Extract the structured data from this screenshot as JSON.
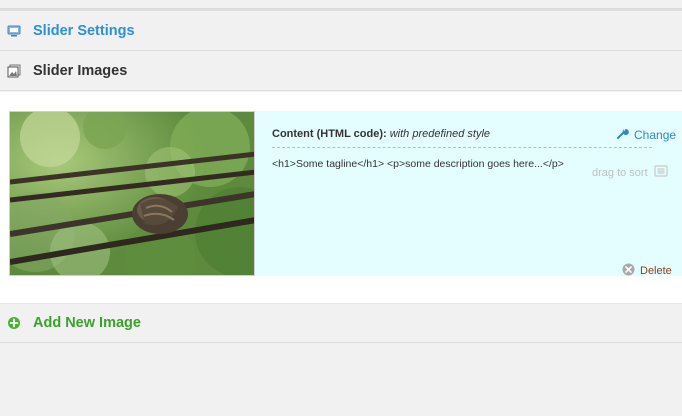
{
  "panels": {
    "settings": {
      "title": "Slider Settings",
      "icon": "monitor-icon"
    },
    "images": {
      "title": "Slider Images",
      "icon": "images-icon"
    },
    "add": {
      "title": "Add New Image",
      "icon": "plus-circle-icon"
    }
  },
  "slide": {
    "thumbnail_alt": "knotted rope against green foliage",
    "content_label": "Content (HTML code):",
    "content_style": "with predefined style",
    "html_code": "<h1>Some tagline</h1> <p>some description goes here...</p>",
    "change_label": "Change",
    "drag_label": "drag to sort",
    "delete_label": "Delete"
  },
  "colors": {
    "accent_blue": "#2f8fd8",
    "add_green": "#3aa32a",
    "delete_red": "#8a3e1a",
    "item_bg": "#e4feff"
  }
}
